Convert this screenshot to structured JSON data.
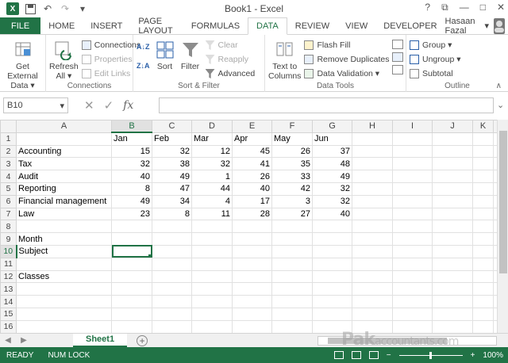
{
  "window": {
    "title": "Book1 - Excel",
    "help": "?",
    "minimize": "—",
    "maximize": "□",
    "close": "✕",
    "ribbon_display": "⧉"
  },
  "qat": {
    "undo": "↶",
    "redo": "↷",
    "customize": "▾"
  },
  "tabs": [
    "FILE",
    "HOME",
    "INSERT",
    "PAGE LAYOUT",
    "FORMULAS",
    "DATA",
    "REVIEW",
    "VIEW",
    "DEVELOPER"
  ],
  "active_tab": "DATA",
  "user": {
    "name": "Hasaan Fazal",
    "dropdown": "▾"
  },
  "ribbon": {
    "get_external": {
      "line1": "Get External",
      "line2": "Data ▾"
    },
    "refresh": {
      "line1": "Refresh",
      "line2": "All ▾"
    },
    "connections": "Connections",
    "properties": "Properties",
    "edit_links": "Edit Links",
    "connections_label": "Connections",
    "sort_az": "A↓Z",
    "sort_za": "Z↓A",
    "sort": "Sort",
    "filter": "Filter",
    "clear": "Clear",
    "reapply": "Reapply",
    "advanced": "Advanced",
    "sort_filter_label": "Sort & Filter",
    "text_to_columns": {
      "line1": "Text to",
      "line2": "Columns"
    },
    "flash_fill": "Flash Fill",
    "remove_duplicates": "Remove Duplicates",
    "data_validation": "Data Validation ▾",
    "data_tools_label": "Data Tools",
    "group": "Group ▾",
    "ungroup": "Ungroup ▾",
    "subtotal": "Subtotal",
    "outline_label": "Outline",
    "collapse": "∧"
  },
  "formula_bar": {
    "name_box": "B10",
    "cancel": "✕",
    "enter": "✓",
    "fx": "fx",
    "value": "",
    "dropdown": "▾",
    "expand": "⌄"
  },
  "columns": [
    "A",
    "B",
    "C",
    "D",
    "E",
    "F",
    "G",
    "H",
    "I",
    "J",
    "K"
  ],
  "rows": [
    [
      "",
      "Jan",
      "Feb",
      "Mar",
      "Apr",
      "May",
      "Jun"
    ],
    [
      "Accounting",
      "15",
      "32",
      "12",
      "45",
      "26",
      "37"
    ],
    [
      "Tax",
      "32",
      "38",
      "32",
      "41",
      "35",
      "48"
    ],
    [
      "Audit",
      "40",
      "49",
      "1",
      "26",
      "33",
      "49"
    ],
    [
      "Reporting",
      "8",
      "47",
      "44",
      "40",
      "42",
      "32"
    ],
    [
      "Financial management",
      "49",
      "34",
      "4",
      "17",
      "3",
      "32"
    ],
    [
      "Law",
      "23",
      "8",
      "11",
      "28",
      "27",
      "40"
    ],
    [
      "",
      "",
      "",
      "",
      "",
      "",
      ""
    ],
    [
      "Month",
      "",
      "",
      "",
      "",
      "",
      ""
    ],
    [
      "Subject",
      "",
      "",
      "",
      "",
      "",
      ""
    ],
    [
      "",
      "",
      "",
      "",
      "",
      "",
      ""
    ],
    [
      "Classes",
      "",
      "",
      "",
      "",
      "",
      ""
    ],
    [
      "",
      "",
      "",
      "",
      "",
      "",
      ""
    ],
    [
      "",
      "",
      "",
      "",
      "",
      "",
      ""
    ],
    [
      "",
      "",
      "",
      "",
      "",
      "",
      ""
    ],
    [
      "",
      "",
      "",
      "",
      "",
      "",
      ""
    ]
  ],
  "active_cell": {
    "row": 10,
    "col": "B"
  },
  "sheets": [
    "Sheet1"
  ],
  "sheet_nav": {
    "prev": "◀",
    "next": "▶",
    "add": "+"
  },
  "status": {
    "ready": "READY",
    "numlock": "NUM LOCK",
    "zoom": "100%",
    "zoom_out": "−",
    "zoom_in": "+"
  },
  "watermark": {
    "main": "Pak",
    "rest": "accountants.com"
  },
  "colors": {
    "accent": "#217346"
  }
}
